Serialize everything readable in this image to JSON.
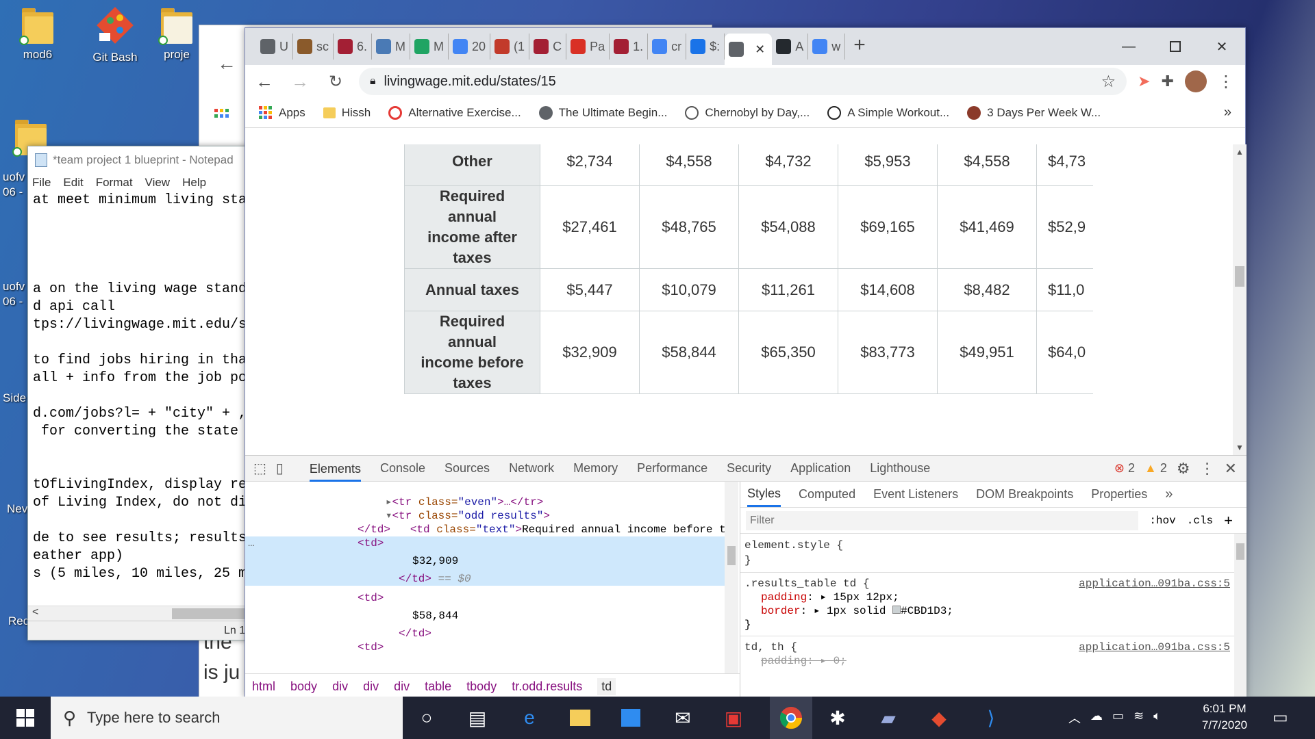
{
  "desktop": {
    "icons": [
      {
        "label": "mod6"
      },
      {
        "label": "Git Bash"
      },
      {
        "label": "proje"
      }
    ],
    "side_labels": [
      "uofv",
      "06 -",
      "uofv",
      "06 -",
      "Side",
      "Nev",
      "Rec"
    ]
  },
  "notepad": {
    "title": "*team project 1 blueprint - Notepad",
    "menu": [
      "File",
      "Edit",
      "Format",
      "View",
      "Help"
    ],
    "lines": [
      "at meet minimum living sta",
      "",
      "",
      "",
      "",
      "a on the living wage stand",
      "d api call",
      "tps://livingwage.mit.edu/s",
      "",
      "to find jobs hiring in tha",
      "all + info from the job po",
      "",
      "d.com/jobs?l= + \"city\" + ,",
      " for converting the state",
      "",
      "",
      "tOfLivingIndex, display re",
      "of Living Index, do not di",
      "",
      "de to see results; results",
      "eather app)",
      "s (5 miles, 10 miles, 25 m"
    ],
    "status": "Ln 1"
  },
  "behind_window": {
    "bottom_text": [
      "the",
      "is ju"
    ]
  },
  "browser": {
    "tabs": [
      {
        "short": "U",
        "color": "#5f6368"
      },
      {
        "short": "sc",
        "color": "#8a5a2b"
      },
      {
        "short": "6.",
        "color": "#a31f34"
      },
      {
        "short": "M",
        "color": "#4a7ab5"
      },
      {
        "short": "M",
        "color": "#1fa463"
      },
      {
        "short": "20",
        "color": "#4285f4"
      },
      {
        "short": "(1",
        "color": "#c23a2b"
      },
      {
        "short": "C",
        "color": "#a31f34"
      },
      {
        "short": "Pa",
        "color": "#d93025"
      },
      {
        "short": "1.",
        "color": "#a31f34"
      },
      {
        "short": "cr",
        "color": "#4285f4"
      },
      {
        "short": "$:",
        "color": "#1a73e8"
      },
      {
        "short": "",
        "color": "#5f6368"
      },
      {
        "short": "A",
        "color": "#24292e"
      },
      {
        "short": "w",
        "color": "#4285f4"
      }
    ],
    "new_tab": "+",
    "url": "livingwage.mit.edu/states/15",
    "bookmarks": [
      {
        "label": "Apps"
      },
      {
        "label": "Hissh"
      },
      {
        "label": "Alternative Exercise..."
      },
      {
        "label": "The Ultimate Begin..."
      },
      {
        "label": "Chernobyl by Day,..."
      },
      {
        "label": "A Simple Workout..."
      },
      {
        "label": "3 Days Per Week W..."
      }
    ],
    "bookmarks_more": "»"
  },
  "results_table": {
    "rows": [
      {
        "label": "Other",
        "values": [
          "$2,734",
          "$4,558",
          "$4,732",
          "$5,953",
          "$4,558",
          "$4,73"
        ]
      },
      {
        "label": "Required annual income after taxes",
        "values": [
          "$27,461",
          "$48,765",
          "$54,088",
          "$69,165",
          "$41,469",
          "$52,9"
        ]
      },
      {
        "label": "Annual taxes",
        "values": [
          "$5,447",
          "$10,079",
          "$11,261",
          "$14,608",
          "$8,482",
          "$11,0"
        ]
      },
      {
        "label": "Required annual income before taxes",
        "values": [
          "$32,909",
          "$58,844",
          "$65,350",
          "$83,773",
          "$49,951",
          "$64,0"
        ]
      }
    ]
  },
  "devtools": {
    "tabs": [
      "Elements",
      "Console",
      "Sources",
      "Network",
      "Memory",
      "Performance",
      "Security",
      "Application",
      "Lighthouse"
    ],
    "errors": "2",
    "warnings": "2",
    "dom": {
      "line1": {
        "open": "<tr",
        "attr": " class=",
        "val": "\"even\"",
        "rest": ">…</tr>"
      },
      "line2": {
        "open": "<tr",
        "attr": " class=",
        "val": "\"odd results\"",
        "rest": ">"
      },
      "line3_tag": "<td",
      "line3_attr": " class=",
      "line3_val": "\"text\"",
      "line3_text": "Required annual income before taxes",
      "td_close": "</td>",
      "td_open": "<td>",
      "value1": "$32,909",
      "selected_marker": "== $0",
      "value2": "$58,844"
    },
    "breadcrumbs": [
      "html",
      "body",
      "div",
      "div",
      "div",
      "table",
      "tbody",
      "tr.odd.results",
      "td"
    ],
    "styles": {
      "subtabs": [
        "Styles",
        "Computed",
        "Event Listeners",
        "DOM Breakpoints",
        "Properties"
      ],
      "subtabs_more": "»",
      "filter_placeholder": "Filter",
      "hov": ":hov",
      "cls": ".cls",
      "add": "+",
      "element_style": "element.style {",
      "close_brace": "}",
      "rule1_selector": ".results_table td {",
      "rule1_source": "application…091ba.css:5",
      "rule1_padding_prop": "padding",
      "rule1_padding_val": "15px 12px;",
      "rule1_border_prop": "border",
      "rule1_border_val": "1px solid",
      "rule1_border_color": "#CBD1D3;",
      "rule2_selector": "td, th {",
      "rule2_source": "application…091ba.css:5",
      "rule2_prop": "padding",
      "rule2_val": "0;"
    }
  },
  "taskbar": {
    "search_placeholder": "Type here to search",
    "time": "6:01 PM",
    "date": "7/7/2020"
  }
}
